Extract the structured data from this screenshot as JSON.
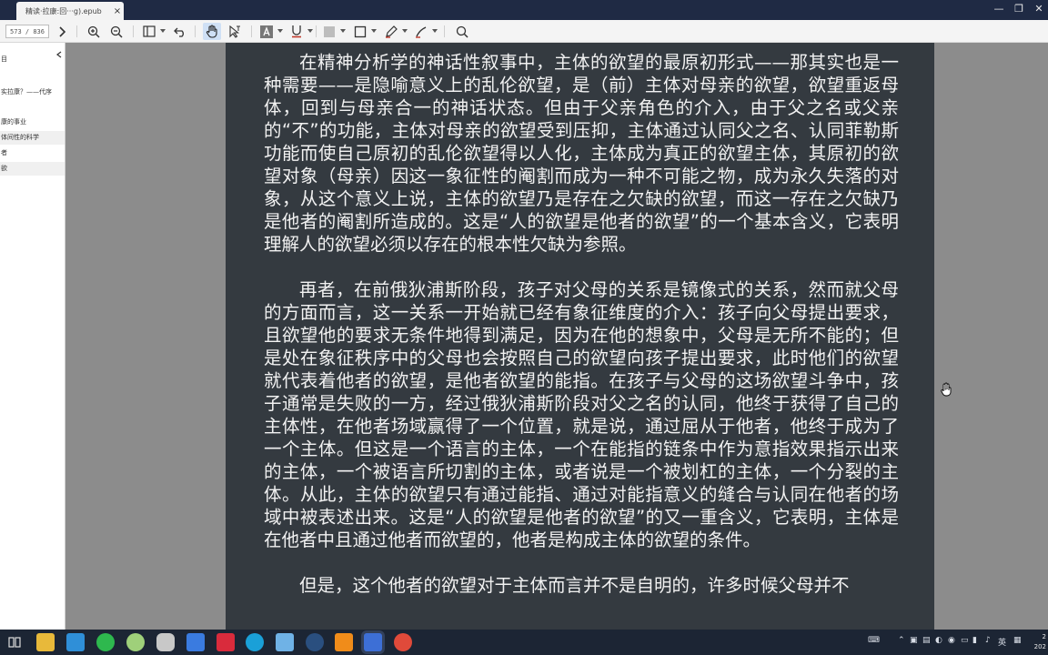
{
  "tab": {
    "title": "精读·拉康:回···g).epub",
    "close": "×"
  },
  "window": {
    "min": "—",
    "max": "❐",
    "close": "✕"
  },
  "toolbar": {
    "page_indicator": "573 / 836",
    "icons": [
      "zoom-in-icon",
      "zoom-out-icon",
      "layout-icon",
      "undo-icon",
      "hand-icon",
      "select-icon",
      "text-highlight-icon",
      "underline-icon",
      "area-icon",
      "shape-icon",
      "pen-icon",
      "marker-icon",
      "search-icon"
    ]
  },
  "sidebar": {
    "items": [
      {
        "label": "目"
      },
      {
        "label": "实拉康？——代序"
      },
      {
        "label": "康的事业"
      },
      {
        "label": "体间性的科学",
        "highlight": true
      },
      {
        "label": "者"
      },
      {
        "label": "欲",
        "highlight": true
      }
    ]
  },
  "document": {
    "paragraphs": [
      "在精神分析学的神话性叙事中，主体的欲望的最原初形式——那其实也是一种需要——是隐喻意义上的乱伦欲望，是（前）主体对母亲的欲望，欲望重返母体，回到与母亲合一的神话状态。但由于父亲角色的介入，由于父之名或父亲的“不”的功能，主体对母亲的欲望受到压抑，主体通过认同父之名、认同菲勒斯功能而使自己原初的乱伦欲望得以人化，主体成为真正的欲望主体，其原初的欲望对象（母亲）因这一象征性的阉割而成为一种不可能之物，成为永久失落的对象，从这个意义上说，主体的欲望乃是存在之欠缺的欲望，而这一存在之欠缺乃是他者的阉割所造成的。这是“人的欲望是他者的欲望”的一个基本含义，它表明理解人的欲望必须以存在的根本性欠缺为参照。",
      "再者，在前俄狄浦斯阶段，孩子对父母的关系是镜像式的关系，然而就父母的方面而言，这一关系一开始就已经有象征维度的介入：孩子向父母提出要求，且欲望他的要求无条件地得到满足，因为在他的想象中，父母是无所不能的；但是处在象征秩序中的父母也会按照自己的欲望向孩子提出要求，此时他们的欲望就代表着他者的欲望，是他者欲望的能指。在孩子与父母的这场欲望斗争中，孩子通常是失败的一方，经过俄狄浦斯阶段对父之名的认同，他终于获得了自己的主体性，在他者场域赢得了一个位置，就是说，通过屈从于他者，他终于成为了一个主体。但这是一个语言的主体，一个在能指的链条中作为意指效果指示出来的主体，一个被语言所切割的主体，或者说是一个被划杠的主体，一个分裂的主体。从此，主体的欲望只有通过能指、通过对能指意义的缝合与认同在他者的场域中被表述出来。这是“人的欲望是他者的欲望”的又一重含义，它表明，主体是在他者中且通过他者而欲望的，他者是构成主体的欲望的条件。",
      "但是，这个他者的欲望对于主体而言并不是自明的，许多时候父母并不"
    ]
  },
  "taskbar": {
    "tray": {
      "lang": "英",
      "clock_top": "2",
      "clock_bottom": "202"
    },
    "apps": [
      "start",
      "file-explorer",
      "mail",
      "browser",
      "app-green",
      "app-car",
      "feishu",
      "netease",
      "edge",
      "remote",
      "xiaomi",
      "vlc",
      "reader",
      "app-red"
    ]
  },
  "colors": {
    "page_bg": "#343a40",
    "text": "#f2f2f2",
    "viewer_bg": "#8c8c8c",
    "taskbar": "#1c2534"
  }
}
